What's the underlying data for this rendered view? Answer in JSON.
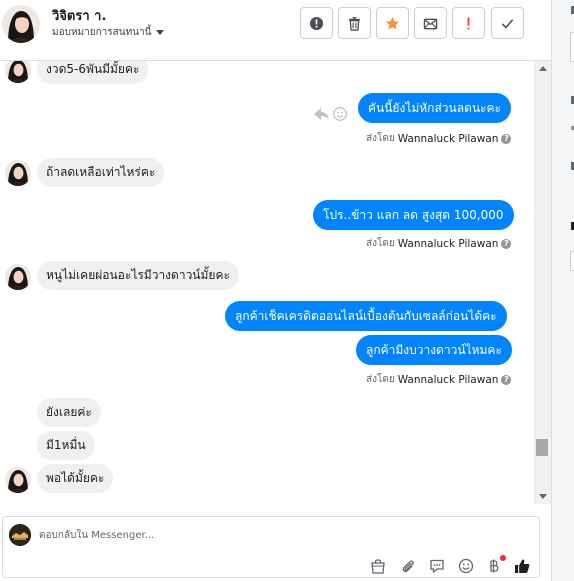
{
  "header": {
    "contact_name": "วิจิตรา า.",
    "assign_label": "มอบหมายการสนทนานี้",
    "actions": [
      {
        "name": "alert-button",
        "icon": "exclamation-circle-icon"
      },
      {
        "name": "delete-button",
        "icon": "trash-icon"
      },
      {
        "name": "star-button",
        "icon": "star-icon"
      },
      {
        "name": "mark-unread-button",
        "icon": "envelope-icon"
      },
      {
        "name": "spam-button",
        "icon": "exclamation-icon"
      },
      {
        "name": "done-button",
        "icon": "checkmark-icon"
      }
    ]
  },
  "messages": {
    "m1": "งวด5-6พันมีมั้ยคะ",
    "m2": "คันนี้ยังไม่หักส่วนลดนะคะ",
    "m3": "ถ้าลดเหลือเท่าไหร่คะ",
    "m4": "โปร..ข้าว แลก ลด สูงสุด 100,000",
    "m5": "หนูไม่เคยผ่อนอะไรมีวางดาวน์มั้ยคะ",
    "m6": "ลูกค้าเช็คเครดิตออนไลน์เบื้องต้นกับเซลล์ก่อนได้คะ",
    "m7": "ลูกค้ามีงบวางดาวน์ไหมคะ",
    "m8": "ยังเลยค่ะ",
    "m9": "มี1หมื่น",
    "m10": "พอได้มั้ยคะ"
  },
  "sent_by": {
    "prefix": "ส่งโดย",
    "sender": "Wannaluck Pilawan",
    "help": "?"
  },
  "composer": {
    "placeholder": "ตอบกลับใน Messenger..."
  },
  "colors": {
    "outgoing_bubble": "#0084ff",
    "incoming_bubble": "#f0f0f0",
    "star": "#f7923a",
    "spam": "#fa3e3e",
    "like": "#1c1e21"
  }
}
